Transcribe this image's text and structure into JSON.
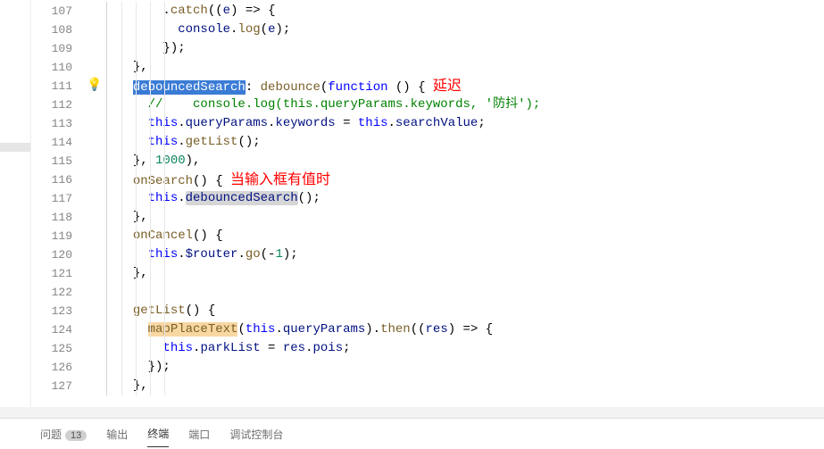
{
  "lines": [
    107,
    108,
    109,
    110,
    111,
    112,
    113,
    114,
    115,
    116,
    117,
    118,
    119,
    120,
    121,
    122,
    123,
    124,
    125,
    126,
    127
  ],
  "glyphs": {
    "111": "bulb"
  },
  "annotations": {
    "delay": "延迟",
    "onInput": "当输入框有值时"
  },
  "code": {
    "107": {
      "indent": 3,
      "tokens": [
        [
          ".",
          "punc"
        ],
        [
          "catch",
          "fn"
        ],
        [
          "((",
          "punc"
        ],
        [
          "e",
          "id"
        ],
        [
          ") ",
          "punc"
        ],
        [
          "=>",
          "op"
        ],
        [
          " {",
          "punc"
        ]
      ]
    },
    "108": {
      "indent": 4,
      "tokens": [
        [
          "console",
          "id"
        ],
        [
          ".",
          "punc"
        ],
        [
          "log",
          "fn"
        ],
        [
          "(",
          "punc"
        ],
        [
          "e",
          "id"
        ],
        [
          ");",
          "punc"
        ]
      ]
    },
    "109": {
      "indent": 3,
      "tokens": [
        [
          "});",
          "punc"
        ]
      ]
    },
    "110": {
      "indent": 1,
      "tokens": [
        [
          "},",
          "punc"
        ]
      ]
    },
    "111": {
      "indent": 1,
      "tokens": [
        [
          "debouncedSearch",
          "sel"
        ],
        [
          ": ",
          "punc"
        ],
        [
          "debounce",
          "fn"
        ],
        [
          "(",
          "punc"
        ],
        [
          "function",
          "kw"
        ],
        [
          " () { ",
          "punc"
        ],
        [
          "延迟",
          "annot-delay"
        ]
      ]
    },
    "112": {
      "indent": 2,
      "tokens": [
        [
          "//    console.log(this.queryParams.keywords, '防抖');",
          "com"
        ]
      ]
    },
    "113": {
      "indent": 2,
      "tokens": [
        [
          "this",
          "kw"
        ],
        [
          ".",
          "punc"
        ],
        [
          "queryParams",
          "id"
        ],
        [
          ".",
          "punc"
        ],
        [
          "keywords",
          "id"
        ],
        [
          " = ",
          "op"
        ],
        [
          "this",
          "kw"
        ],
        [
          ".",
          "punc"
        ],
        [
          "searchValue",
          "id"
        ],
        [
          ";",
          "punc"
        ]
      ]
    },
    "114": {
      "indent": 2,
      "tokens": [
        [
          "this",
          "kw"
        ],
        [
          ".",
          "punc"
        ],
        [
          "getList",
          "fn"
        ],
        [
          "();",
          "punc"
        ]
      ]
    },
    "115": {
      "indent": 1,
      "tokens": [
        [
          "}, ",
          "punc"
        ],
        [
          "1000",
          "num"
        ],
        [
          "),",
          "punc"
        ]
      ]
    },
    "116": {
      "indent": 1,
      "tokens": [
        [
          "onSearch",
          "fn"
        ],
        [
          "() { ",
          "punc"
        ],
        [
          "当输入框有值时",
          "annot-input"
        ]
      ]
    },
    "117": {
      "indent": 2,
      "tokens": [
        [
          "this",
          "kw"
        ],
        [
          ".",
          "punc"
        ],
        [
          "debouncedSearch",
          "word"
        ],
        [
          "();",
          "punc"
        ]
      ]
    },
    "118": {
      "indent": 1,
      "tokens": [
        [
          "},",
          "punc"
        ]
      ]
    },
    "119": {
      "indent": 1,
      "tokens": [
        [
          "onCancel",
          "fn"
        ],
        [
          "() {",
          "punc"
        ]
      ]
    },
    "120": {
      "indent": 2,
      "tokens": [
        [
          "this",
          "kw"
        ],
        [
          ".",
          "punc"
        ],
        [
          "$router",
          "id"
        ],
        [
          ".",
          "punc"
        ],
        [
          "go",
          "fn"
        ],
        [
          "(-",
          "punc"
        ],
        [
          "1",
          "num"
        ],
        [
          ");",
          "punc"
        ]
      ]
    },
    "121": {
      "indent": 1,
      "tokens": [
        [
          "},",
          "punc"
        ]
      ]
    },
    "122": {
      "indent": 0,
      "tokens": []
    },
    "123": {
      "indent": 1,
      "tokens": [
        [
          "getList",
          "fn"
        ],
        [
          "() {",
          "punc"
        ]
      ]
    },
    "124": {
      "indent": 2,
      "tokens": [
        [
          "mapPlaceText",
          "hlfn"
        ],
        [
          "(",
          "punc"
        ],
        [
          "this",
          "kw"
        ],
        [
          ".",
          "punc"
        ],
        [
          "queryParams",
          "id"
        ],
        [
          ").",
          "punc"
        ],
        [
          "then",
          "fn"
        ],
        [
          "((",
          "punc"
        ],
        [
          "res",
          "id"
        ],
        [
          ") ",
          "punc"
        ],
        [
          "=>",
          "op"
        ],
        [
          " {",
          "punc"
        ]
      ]
    },
    "125": {
      "indent": 3,
      "tokens": [
        [
          "this",
          "kw"
        ],
        [
          ".",
          "punc"
        ],
        [
          "parkList",
          "id"
        ],
        [
          " = ",
          "op"
        ],
        [
          "res",
          "id"
        ],
        [
          ".",
          "punc"
        ],
        [
          "pois",
          "id"
        ],
        [
          ";",
          "punc"
        ]
      ]
    },
    "126": {
      "indent": 2,
      "tokens": [
        [
          "});",
          "punc"
        ]
      ]
    },
    "127": {
      "indent": 1,
      "tokens": [
        [
          "},",
          "punc"
        ]
      ]
    }
  },
  "panel": {
    "tabs": [
      {
        "id": "problems",
        "label": "问题",
        "badge": "13",
        "active": false
      },
      {
        "id": "output",
        "label": "输出",
        "active": false
      },
      {
        "id": "terminal",
        "label": "终端",
        "active": true
      },
      {
        "id": "ports",
        "label": "端口",
        "active": false
      },
      {
        "id": "debug",
        "label": "调试控制台",
        "active": false
      }
    ]
  }
}
